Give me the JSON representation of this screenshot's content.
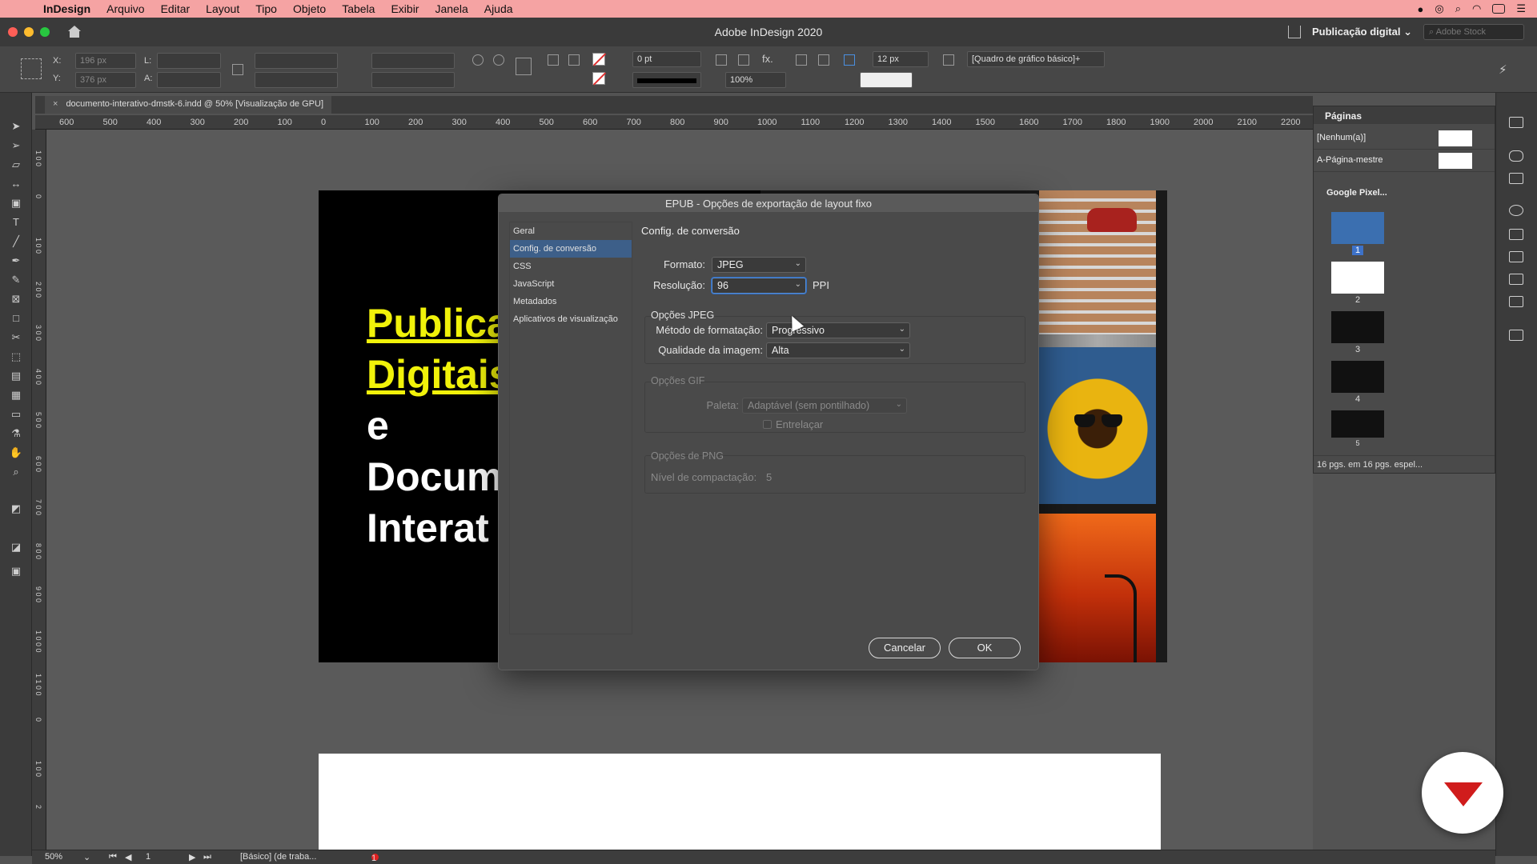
{
  "menubar": {
    "app_name": "InDesign",
    "items": [
      "Arquivo",
      "Editar",
      "Layout",
      "Tipo",
      "Objeto",
      "Tabela",
      "Exibir",
      "Janela",
      "Ajuda"
    ]
  },
  "window": {
    "title": "Adobe InDesign 2020",
    "workspace": "Publicação digital",
    "stock_placeholder": "Adobe Stock"
  },
  "controlbar": {
    "x_label": "X:",
    "x_value": "196 px",
    "y_label": "Y:",
    "y_value": "376 px",
    "w_label": "L:",
    "h_label": "A:",
    "stroke_weight": "0 pt",
    "opacity": "100%",
    "gap_value": "12 px",
    "object_style": "[Quadro de gráfico básico]+"
  },
  "document_tab": {
    "close": "×",
    "label": "documento-interativo-dmstk-6.indd @ 50% [Visualização de GPU]"
  },
  "ruler": {
    "h_ticks": [
      "600",
      "500",
      "400",
      "300",
      "200",
      "100",
      "0",
      "100",
      "200",
      "300",
      "400",
      "500",
      "600",
      "700",
      "800",
      "900",
      "1000",
      "1100",
      "1200",
      "1300",
      "1400",
      "1500",
      "1600",
      "1700",
      "1800",
      "1900",
      "2000",
      "2100",
      "2200"
    ],
    "v_ticks": [
      "1 0 0",
      "0",
      "1 0 0",
      "2 0 0",
      "3 0 0",
      "4 0 0",
      "5 0 0",
      "6 0 0",
      "7 0 0",
      "8 0 0",
      "9 0 0",
      "1 0 0 0",
      "1 1 0 0",
      "0",
      "1 0 0",
      "2"
    ]
  },
  "page1": {
    "line1": "Publica",
    "line2": "Digitais",
    "line3": "e",
    "line4": "Docum",
    "line5": "Interat"
  },
  "dialog": {
    "title": "EPUB - Opções de exportação de layout fixo",
    "nav": [
      "Geral",
      "Config. de conversão",
      "CSS",
      "JavaScript",
      "Metadados",
      "Aplicativos de visualização"
    ],
    "selected_nav": 1,
    "heading": "Config. de conversão",
    "format_label": "Formato:",
    "format_value": "JPEG",
    "resolution_label": "Resolução:",
    "resolution_value": "96",
    "resolution_unit": "PPI",
    "jpeg_group": "Opções JPEG",
    "method_label": "Método de formatação:",
    "method_value": "Progressivo",
    "quality_label": "Qualidade da imagem:",
    "quality_value": "Alta",
    "gif_group": "Opções GIF",
    "palette_label": "Paleta:",
    "palette_value": "Adaptável (sem pontilhado)",
    "interlace_label": "Entrelaçar",
    "png_group": "Opções de PNG",
    "compression_label": "Nível de compactação:",
    "compression_value": "5",
    "cancel": "Cancelar",
    "ok": "OK"
  },
  "pages_panel": {
    "title": "Páginas",
    "none_label": "[Nenhum(a)]",
    "master_label": "A-Página-mestre",
    "section_label": "Google Pixel...",
    "page_numbers": [
      "1",
      "2",
      "3",
      "4",
      "5"
    ],
    "footer": "16 pgs. em 16 pgs. espel..."
  },
  "statusbar": {
    "zoom": "50%",
    "page": "1",
    "profile": "[Básico] (de traba...",
    "errors": "1 erro"
  }
}
